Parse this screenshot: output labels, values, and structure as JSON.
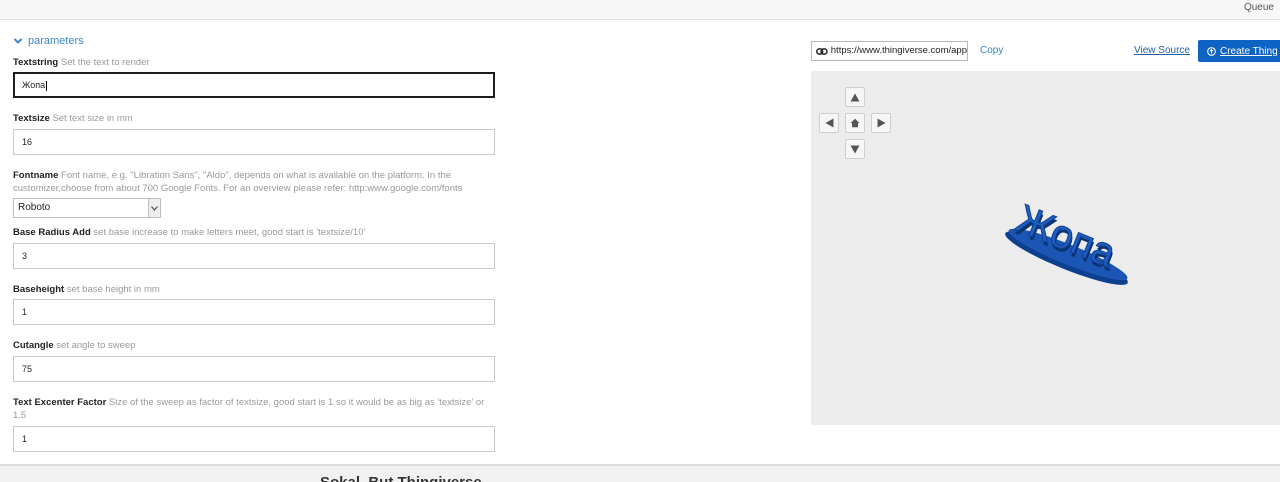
{
  "topbar": {
    "queue_label": "Queue"
  },
  "parameters": {
    "toggle_label": "parameters",
    "fields": [
      {
        "name": "Textstring",
        "description": "Set the text to render",
        "value": "Жопа"
      },
      {
        "name": "Textsize",
        "description": "Set text size in mm",
        "value": "16"
      },
      {
        "name": "Fontname",
        "description": "Font name, e.g. \"Libration Sans\", \"Aldo\", depends on what is available on the platform. In the customizer,choose from about 700 Google Fonts. For an overview please refer: http:www.google.com/fonts",
        "value": "Roboto"
      },
      {
        "name": "Base Radius Add",
        "description": "set base increase to make letters meet, good start is 'textsize/10'",
        "value": "3"
      },
      {
        "name": "Baseheight",
        "description": "set base height in mm",
        "value": "1"
      },
      {
        "name": "Cutangle",
        "description": "set angle to sweep",
        "value": "75"
      },
      {
        "name": "Text Excenter Factor",
        "description": "Size of the sweep as factor of textsize, good start is 1 so it would be as big as 'textsize' or 1.5",
        "value": "1"
      }
    ]
  },
  "share": {
    "url": "https://www.thingiverse.com/app",
    "copy_label": "Copy",
    "view_source_label": "View Source",
    "create_label": "Create Thing"
  },
  "viewer": {
    "model_text": "Жопа",
    "model_color": "#1f5fc4",
    "icons": [
      "arrow-up-icon",
      "arrow-left-icon",
      "home-icon",
      "arrow-right-icon",
      "arrow-down-icon"
    ]
  },
  "footer": {
    "title": "Sokal, But Thingiverse"
  }
}
